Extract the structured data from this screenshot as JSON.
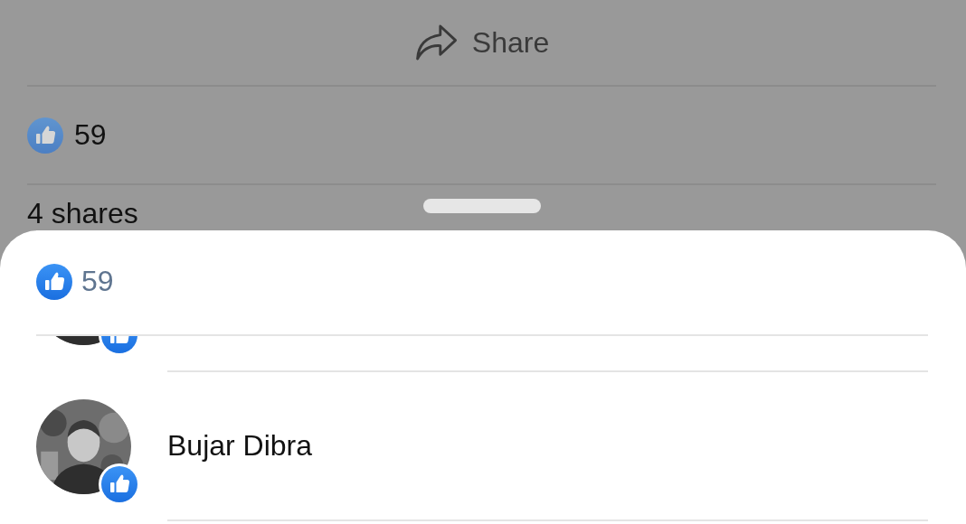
{
  "post": {
    "share_button": "Share",
    "like_count": "59",
    "shares": "4 shares"
  },
  "reactions_sheet": {
    "like_count": "59",
    "people": [
      {
        "liked": true
      },
      {
        "name": "Bujar Dibra",
        "liked": true
      }
    ]
  }
}
